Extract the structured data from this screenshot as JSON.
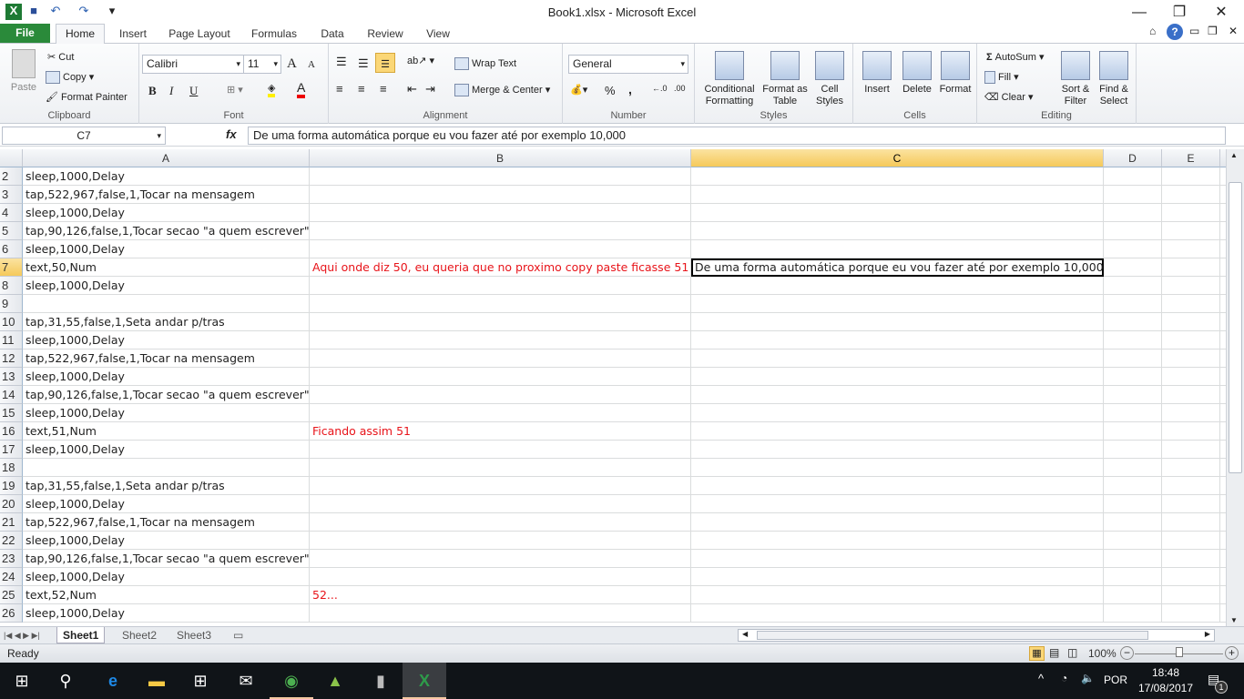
{
  "window": {
    "title": "Book1.xlsx - Microsoft Excel",
    "minimize": "—",
    "restore": "❐",
    "close": "✕"
  },
  "quick_access": [
    {
      "icon": "excel-logo-icon",
      "glyph": "X"
    },
    {
      "icon": "save-icon",
      "glyph": "💾"
    },
    {
      "icon": "undo-icon",
      "glyph": "↶"
    },
    {
      "icon": "redo-icon",
      "glyph": "↷"
    },
    {
      "icon": "customize-icon",
      "glyph": "▾"
    }
  ],
  "ribbon_tabs": [
    "File",
    "Home",
    "Insert",
    "Page Layout",
    "Formulas",
    "Data",
    "Review",
    "View"
  ],
  "ribbon": {
    "clipboard": {
      "label": "Clipboard",
      "paste": "Paste",
      "cut": "Cut",
      "copy": "Copy",
      "format_painter": "Format Painter"
    },
    "font": {
      "label": "Font",
      "name": "Calibri",
      "size": "11",
      "bold": "B",
      "italic": "I",
      "underline": "U",
      "grow": "A",
      "shrink": "A"
    },
    "alignment": {
      "label": "Alignment",
      "wrap": "Wrap Text",
      "merge": "Merge & Center"
    },
    "number": {
      "label": "Number",
      "format": "General",
      "percent": "%",
      "comma": ",",
      "inc": ".0",
      "dec": ".00"
    },
    "styles": {
      "label": "Styles",
      "conditional": "Conditional Formatting",
      "table": "Format as Table",
      "cell": "Cell Styles"
    },
    "cells": {
      "label": "Cells",
      "insert": "Insert",
      "delete": "Delete",
      "format": "Format"
    },
    "editing": {
      "label": "Editing",
      "autosum": "AutoSum",
      "fill": "Fill",
      "clear": "Clear",
      "sort": "Sort & Filter",
      "find": "Find & Select"
    }
  },
  "formula_bar": {
    "name_box": "C7",
    "fx": "fx",
    "value": "De uma forma automática porque eu vou fazer até por exemplo 10,000"
  },
  "columns": [
    "A",
    "B",
    "C",
    "D",
    "E"
  ],
  "selected_column": "C",
  "rows": [
    {
      "n": "2",
      "a": "sleep,1000,Delay",
      "b": "",
      "c": ""
    },
    {
      "n": "3",
      "a": "tap,522,967,false,1,Tocar na mensagem",
      "b": "",
      "c": ""
    },
    {
      "n": "4",
      "a": "sleep,1000,Delay",
      "b": "",
      "c": ""
    },
    {
      "n": "5",
      "a": "tap,90,126,false,1,Tocar secao \"a quem escrever\"",
      "b": "",
      "c": ""
    },
    {
      "n": "6",
      "a": "sleep,1000,Delay",
      "b": "",
      "c": ""
    },
    {
      "n": "7",
      "a": "text,50,Num",
      "b": "Aqui onde diz 50, eu queria que no proximo copy paste ficasse 51",
      "c": "De uma forma automática porque eu vou fazer até por exemplo 10,000"
    },
    {
      "n": "8",
      "a": "sleep,1000,Delay",
      "b": "",
      "c": ""
    },
    {
      "n": "9",
      "a": "",
      "b": "",
      "c": ""
    },
    {
      "n": "10",
      "a": "tap,31,55,false,1,Seta andar p/tras",
      "b": "",
      "c": ""
    },
    {
      "n": "11",
      "a": "sleep,1000,Delay",
      "b": "",
      "c": ""
    },
    {
      "n": "12",
      "a": "tap,522,967,false,1,Tocar na mensagem",
      "b": "",
      "c": ""
    },
    {
      "n": "13",
      "a": "sleep,1000,Delay",
      "b": "",
      "c": ""
    },
    {
      "n": "14",
      "a": "tap,90,126,false,1,Tocar secao \"a quem escrever\"",
      "b": "",
      "c": ""
    },
    {
      "n": "15",
      "a": "sleep,1000,Delay",
      "b": "",
      "c": ""
    },
    {
      "n": "16",
      "a": "text,51,Num",
      "b": "Ficando assim 51",
      "c": ""
    },
    {
      "n": "17",
      "a": "sleep,1000,Delay",
      "b": "",
      "c": ""
    },
    {
      "n": "18",
      "a": "",
      "b": "",
      "c": ""
    },
    {
      "n": "19",
      "a": "tap,31,55,false,1,Seta andar p/tras",
      "b": "",
      "c": ""
    },
    {
      "n": "20",
      "a": "sleep,1000,Delay",
      "b": "",
      "c": ""
    },
    {
      "n": "21",
      "a": "tap,522,967,false,1,Tocar na mensagem",
      "b": "",
      "c": ""
    },
    {
      "n": "22",
      "a": "sleep,1000,Delay",
      "b": "",
      "c": ""
    },
    {
      "n": "23",
      "a": "tap,90,126,false,1,Tocar secao \"a quem escrever\"",
      "b": "",
      "c": ""
    },
    {
      "n": "24",
      "a": "sleep,1000,Delay",
      "b": "",
      "c": ""
    },
    {
      "n": "25",
      "a": "text,52,Num",
      "b": "52...",
      "c": ""
    },
    {
      "n": "26",
      "a": "sleep,1000,Delay",
      "b": "",
      "c": ""
    }
  ],
  "active_cell": {
    "row": "7",
    "col": "C"
  },
  "colors": {
    "red_text": "#e8141a",
    "file_tab": "#2a8a3a",
    "selected_header": "#f5c95a"
  },
  "sheets": [
    "Sheet1",
    "Sheet2",
    "Sheet3"
  ],
  "active_sheet": "Sheet1",
  "status": {
    "text": "Ready",
    "zoom": "100%"
  },
  "taskbar": {
    "apps": [
      "start",
      "search",
      "edge",
      "file-explorer",
      "store",
      "mail",
      "chrome",
      "android-studio",
      "app",
      "excel"
    ],
    "language": "POR",
    "time": "18:48",
    "date": "17/08/2017",
    "notifications": "1"
  }
}
